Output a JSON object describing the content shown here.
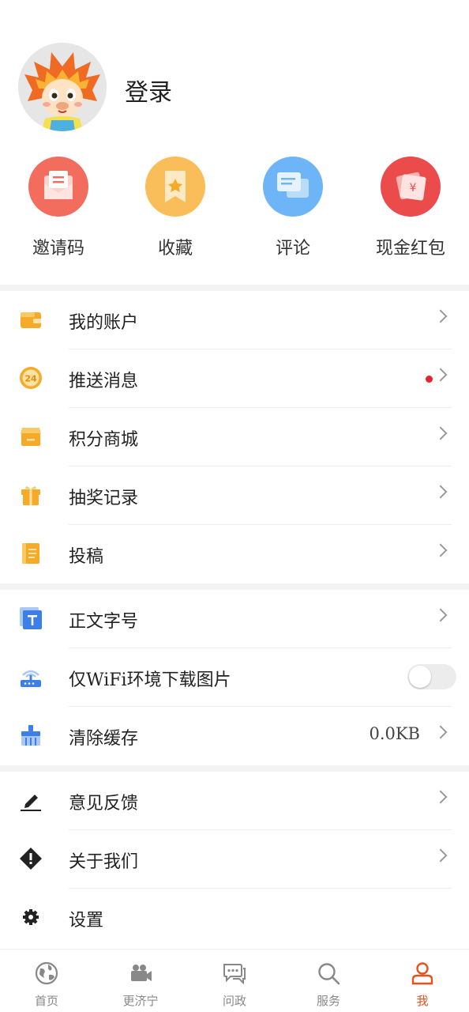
{
  "profile": {
    "login_label": "登录"
  },
  "quick_actions": [
    {
      "label": "邀请码",
      "icon": "envelope-icon",
      "color": "#f36d5f"
    },
    {
      "label": "收藏",
      "icon": "bookmark-icon",
      "color": "#f9bd5a"
    },
    {
      "label": "评论",
      "icon": "comment-icon",
      "color": "#6eb5f7"
    },
    {
      "label": "现金红包",
      "icon": "red-envelope-icon",
      "color": "#ec4b4c"
    }
  ],
  "menu_group_1": [
    {
      "label": "我的账户",
      "icon": "wallet-icon"
    },
    {
      "label": "推送消息",
      "icon": "push-24-icon",
      "has_badge": true
    },
    {
      "label": "积分商城",
      "icon": "store-icon"
    },
    {
      "label": "抽奖记录",
      "icon": "gift-icon"
    },
    {
      "label": "投稿",
      "icon": "notebook-icon"
    }
  ],
  "menu_group_2": [
    {
      "label": "正文字号",
      "icon": "font-size-icon"
    },
    {
      "label": "仅WiFi环境下载图片",
      "icon": "router-icon",
      "toggle_on": false
    },
    {
      "label": "清除缓存",
      "icon": "broom-icon",
      "value": "0.0KB"
    }
  ],
  "menu_group_3": [
    {
      "label": "意见反馈",
      "icon": "pencil-icon"
    },
    {
      "label": "关于我们",
      "icon": "info-diamond-icon"
    },
    {
      "label": "设置",
      "icon": "gear-icon"
    }
  ],
  "tabbar": [
    {
      "label": "首页",
      "icon": "globe-icon",
      "active": false
    },
    {
      "label": "更济宁",
      "icon": "video-camera-icon",
      "active": false
    },
    {
      "label": "问政",
      "icon": "chat-bubbles-icon",
      "active": false
    },
    {
      "label": "服务",
      "icon": "search-icon",
      "active": false
    },
    {
      "label": "我",
      "icon": "person-icon",
      "active": true
    }
  ],
  "colors": {
    "accent": "#e8511c",
    "badge": "#e8232a",
    "icon_orange": "#f7a928",
    "icon_blue": "#3d7fe8"
  }
}
